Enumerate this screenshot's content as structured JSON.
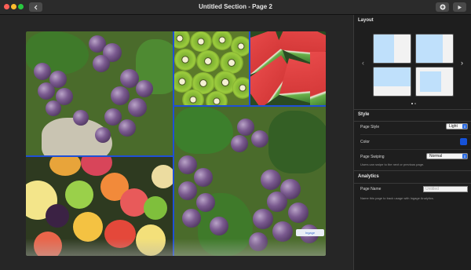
{
  "window": {
    "title": "Untitled Section - Page 2",
    "back_icon": "chevron-left-icon",
    "add_icon": "plus-circle-icon",
    "play_icon": "play-icon"
  },
  "canvas": {
    "watermark": "Ingage"
  },
  "sidebar": {
    "layout": {
      "title": "Layout",
      "page_dots": 2,
      "active_dot": 1
    },
    "style": {
      "title": "Style",
      "page_style_label": "Page Style",
      "page_style_value": "Light",
      "color_label": "Color",
      "color_value": "#1552d9",
      "page_swiping_label": "Page Swiping",
      "page_swiping_value": "Normal",
      "page_swiping_help": "Users can swipe to the next or previous page."
    },
    "analytics": {
      "title": "Analytics",
      "page_name_label": "Page Name",
      "page_name_placeholder": "Untitled",
      "page_name_help": "Name this page to track usage with Ingage Analytics."
    }
  },
  "colors": {
    "divider": "#1f4fd6",
    "accent": "#2b6be0"
  }
}
